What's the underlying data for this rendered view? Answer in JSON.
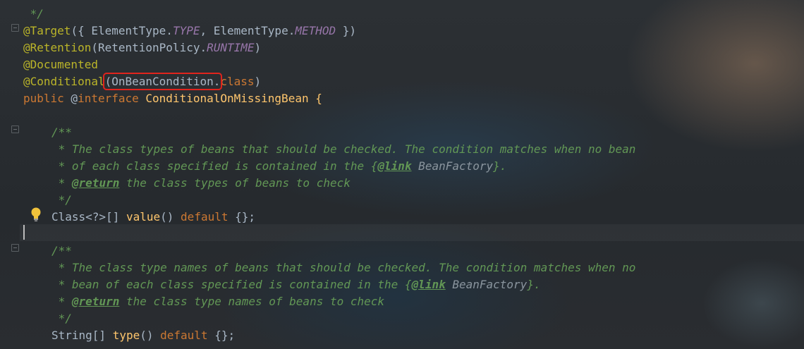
{
  "editor": {
    "line0": " */",
    "target": {
      "anno": "@Target",
      "open": "({ ",
      "et1": "ElementType.",
      "type": "TYPE",
      "comma": ", ",
      "et2": "ElementType.",
      "method": "METHOD",
      "close": " })"
    },
    "retention": {
      "anno": "@Retention",
      "open": "(",
      "rp": "RetentionPolicy.",
      "runtime": "RUNTIME",
      "close": ")"
    },
    "documented": "@Documented",
    "conditional": {
      "anno": "@Conditional",
      "open": "(",
      "highlighted": "OnBeanCondition.",
      "cls": "class",
      "close": ")"
    },
    "decl": {
      "kw": "public",
      "at": " @",
      "iface": "interface",
      "name": " ConditionalOnMissingBean {"
    },
    "doc1": {
      "open": "/**",
      "l1": " * The class types of beans that should be checked. The condition matches when no bean",
      "l2a": " * of each class specified is contained in the {",
      "link": "@link",
      "l2b": " BeanFactory",
      "l2c": "}.",
      "l3a": " * ",
      "ret": "@return",
      "l3b": " the class types of beans to check",
      "close": " */"
    },
    "value_line": {
      "type": "Class<?>[] ",
      "fn": "value",
      "paren": "() ",
      "kw": "default",
      "rest": " {};"
    },
    "doc2": {
      "open": "/**",
      "l1": " * The class type names of beans that should be checked. The condition matches when no",
      "l2a": " * bean of each class specified is contained in the {",
      "link": "@link",
      "l2b": " BeanFactory",
      "l2c": "}.",
      "l3a": " * ",
      "ret": "@return",
      "l3b": " the class type names of beans to check",
      "close": " */"
    },
    "type_line": {
      "type": "String[] ",
      "fn": "type",
      "paren": "() ",
      "kw": "default",
      "rest": " {};"
    }
  },
  "icons": {
    "bulb": "lightbulb-icon",
    "fold": "fold-marker-icon"
  },
  "colors": {
    "highlight_border": "#e0241d",
    "annotation": "#bbb529",
    "keyword": "#cc7832",
    "comment": "#629755",
    "constant": "#9876aa",
    "method": "#ffc66d"
  }
}
